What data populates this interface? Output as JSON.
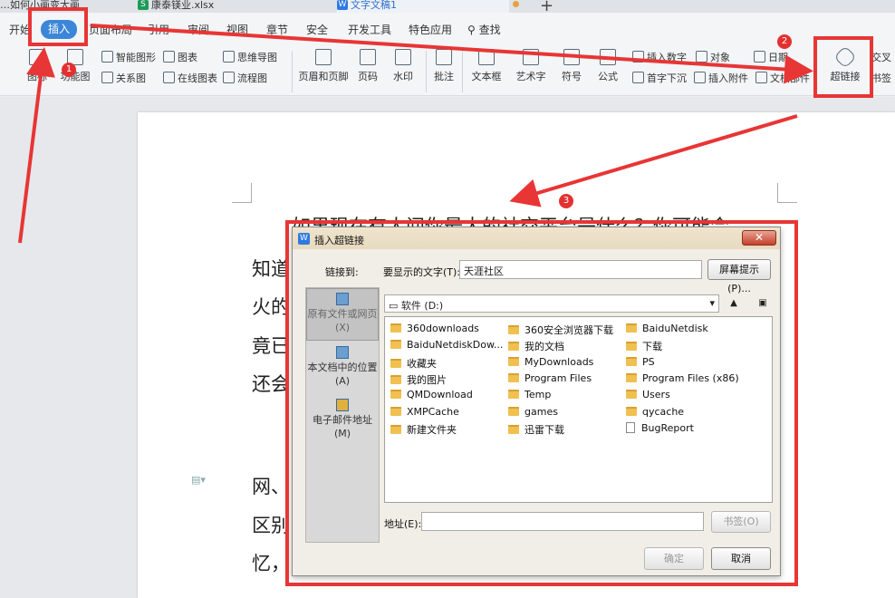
{
  "tabs": [
    {
      "label": "…如何小画变大画",
      "icon": ""
    },
    {
      "label": "康泰镁业.xlsx",
      "icon": "S"
    },
    {
      "label": "文字文稿1",
      "icon": "W"
    }
  ],
  "menu": [
    "开始",
    "插入",
    "页面布局",
    "引用",
    "审阅",
    "视图",
    "章节",
    "安全",
    "开发工具",
    "特色应用",
    "查找"
  ],
  "toolbar": {
    "smart_shape": "智能图形",
    "chart": "图表",
    "mind_map": "思维导图",
    "relation": "关系图",
    "online_chart": "在线图表",
    "flowchart": "流程图",
    "header_footer": "页眉和页脚",
    "page_number": "页码",
    "watermark": "水印",
    "comment": "批注",
    "textbox": "文本框",
    "art_text": "艺术字",
    "symbol": "符号",
    "formula": "公式",
    "insert_number": "插入数字",
    "object": "对象",
    "date": "日期",
    "drop_cap": "首字下沉",
    "attachment": "插入附件",
    "doc_parts": "文档部件",
    "hyperlink": "超链接",
    "cross_ref": "交叉",
    "bookmark": "书签",
    "shapes": "图标",
    "function_chart": "功能图"
  },
  "document": {
    "line1": "如果现在有人问你最大的社交平台是什么？你可能会",
    "l2": "知道",
    "l3": "火的",
    "l4": "竟已",
    "l5": "还会",
    "l6": "网、",
    "l7": "区别",
    "l8": "忆，"
  },
  "dialog": {
    "title": "插入超链接",
    "link_to_label": "链接到:",
    "display_text_label": "要显示的文字(T):",
    "display_text_value": "天涯社区",
    "screen_tip_button": "屏幕提示(P)...",
    "drive": "软件 (D:)",
    "places": [
      "原有文件或网页(X)",
      "本文档中的位置(A)",
      "电子邮件地址(M)"
    ],
    "files": [
      [
        "360downloads",
        "360安全浏览器下载",
        "BaiduNetdisk"
      ],
      [
        "BaiduNetdiskDow...",
        "我的文档",
        "下载"
      ],
      [
        "收藏夹",
        "MyDownloads",
        "PS"
      ],
      [
        "我的图片",
        "Program Files",
        "Program Files (x86)"
      ],
      [
        "QMDownload",
        "Temp",
        "Users"
      ],
      [
        "XMPCache",
        "games",
        "qycache"
      ],
      [
        "新建文件夹",
        "迅雷下载",
        "BugReport"
      ]
    ],
    "address_label": "地址(E):",
    "address_value": "",
    "bookmark_button": "书签(O)",
    "ok_button": "确定",
    "cancel_button": "取消"
  },
  "annotations": [
    "1",
    "2",
    "3"
  ],
  "colors": {
    "annotation_red": "#e83535",
    "accent_blue": "#3c86d8"
  }
}
